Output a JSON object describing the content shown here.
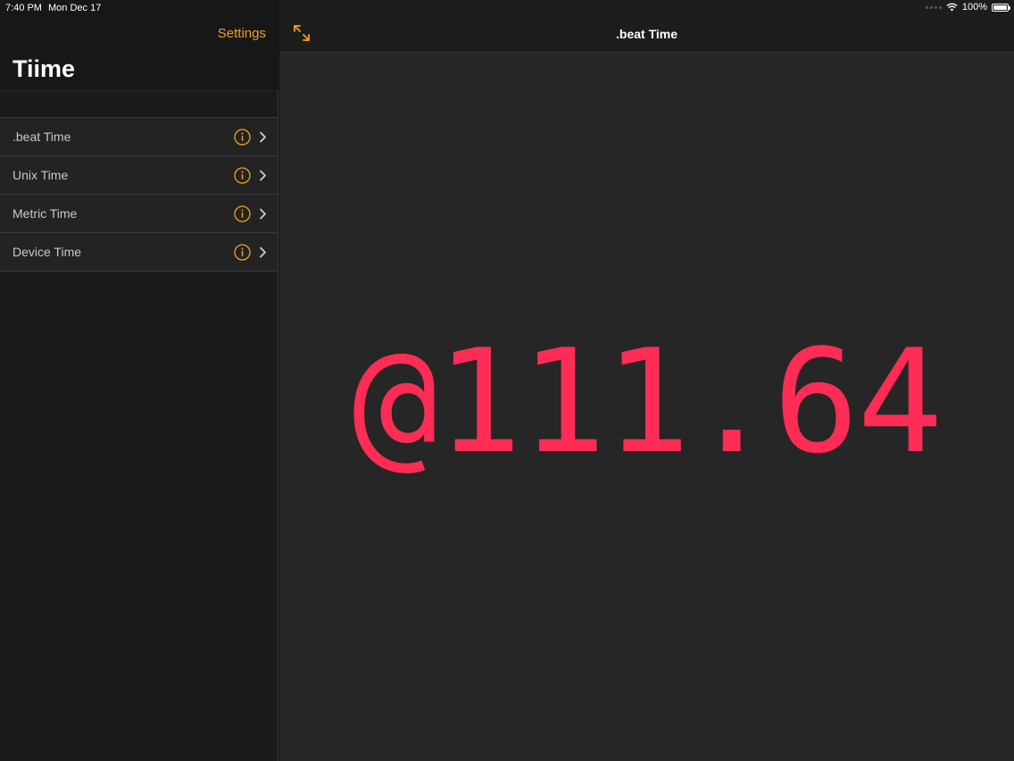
{
  "status_bar": {
    "time": "7:40 PM",
    "date": "Mon Dec 17",
    "battery": "100%",
    "wifi_icon": "wifi-icon",
    "battery_icon": "battery-icon"
  },
  "sidebar": {
    "settings_label": "Settings",
    "title": "Tiime",
    "items": [
      {
        "label": ".beat Time",
        "info_icon": "info-icon",
        "chevron_icon": "chevron-right-icon"
      },
      {
        "label": "Unix Time",
        "info_icon": "info-icon",
        "chevron_icon": "chevron-right-icon"
      },
      {
        "label": "Metric Time",
        "info_icon": "info-icon",
        "chevron_icon": "chevron-right-icon"
      },
      {
        "label": "Device Time",
        "info_icon": "info-icon",
        "chevron_icon": "chevron-right-icon"
      }
    ]
  },
  "detail": {
    "title": ".beat Time",
    "expand_icon": "expand-arrows-icon",
    "time_value": "@111.64"
  },
  "colors": {
    "accent": "#f0a020",
    "time_text": "#ff2d55",
    "sidebar_bg": "#1a1a1b",
    "detail_bg": "#262626"
  }
}
